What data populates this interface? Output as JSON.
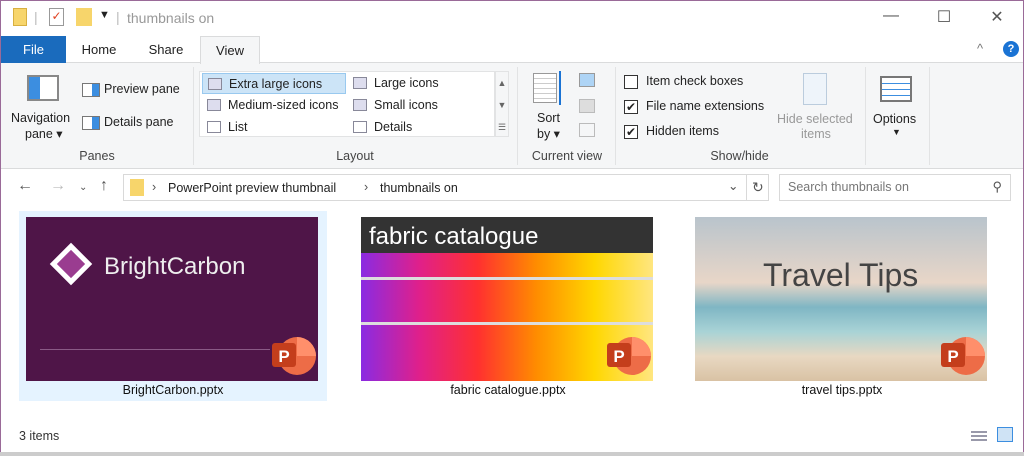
{
  "window": {
    "title": "thumbnails on",
    "minimize": "—",
    "maximize": "☐",
    "close": "✕"
  },
  "tabs": [
    {
      "label": "File"
    },
    {
      "label": "Home"
    },
    {
      "label": "Share"
    },
    {
      "label": "View"
    }
  ],
  "ribbon": {
    "panes": {
      "label": "Panes",
      "navigation_pane": "Navigation",
      "navigation_pane2": "pane",
      "preview_pane": "Preview pane",
      "details_pane": "Details pane"
    },
    "layout": {
      "label": "Layout",
      "items": [
        "Extra large icons",
        "Large icons",
        "Medium-sized icons",
        "Small icons",
        "List",
        "Details"
      ],
      "selected": "Extra large icons"
    },
    "current_view": {
      "label": "Current view",
      "sort_by": "Sort",
      "sort_by2": "by"
    },
    "show_hide": {
      "label": "Show/hide",
      "item_check_boxes": {
        "label": "Item check boxes",
        "checked": false
      },
      "file_name_extensions": {
        "label": "File name extensions",
        "checked": true
      },
      "hidden_items": {
        "label": "Hidden items",
        "checked": true
      },
      "hide_selected": "Hide selected",
      "hide_selected2": "items"
    },
    "options": {
      "label": "Options"
    }
  },
  "address": {
    "breadcrumb": [
      "PowerPoint preview thumbnail",
      "thumbnails on"
    ],
    "search_placeholder": "Search thumbnails on"
  },
  "files": [
    {
      "name": "BrightCarbon.pptx",
      "thumb_title": "BrightCarbon",
      "selected": true
    },
    {
      "name": "fabric catalogue.pptx",
      "thumb_title": "fabric catalogue",
      "selected": false
    },
    {
      "name": "travel tips.pptx",
      "thumb_title": "Travel Tips",
      "selected": false
    }
  ],
  "status": {
    "count": "3 items"
  },
  "colors": {
    "file_tab": "#1a6bbd",
    "selection": "#e5f3ff",
    "brightcarbon_bg": "#4f1548",
    "powerpoint": "#d04423"
  }
}
